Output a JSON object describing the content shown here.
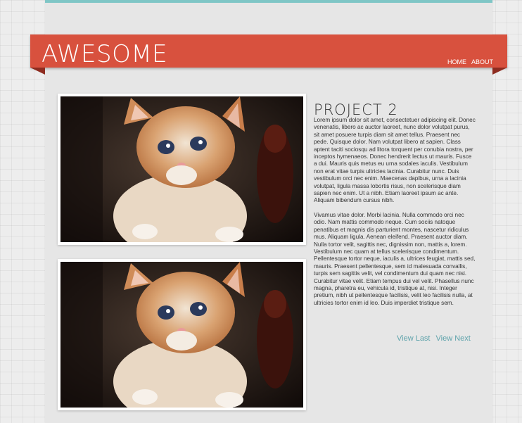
{
  "header": {
    "logo": "AWESOME",
    "nav": [
      {
        "label": "HOME"
      },
      {
        "label": "ABOUT"
      }
    ]
  },
  "project": {
    "title": "PROJECT 2",
    "paragraphs": [
      "Lorem ipsum dolor sit amet, consectetuer adipiscing elit. Donec venenatis, libero ac auctor laoreet, nunc dolor volutpat purus, sit amet posuere turpis diam sit amet tellus. Praesent nec pede. Quisque dolor. Nam volutpat libero at sapien. Class aptent taciti sociosqu ad litora torquent per conubia nostra, per inceptos hymenaeos. Donec hendrerit lectus ut mauris. Fusce a dui. Mauris quis metus eu urna sodales iaculis. Vestibulum non erat vitae turpis ultricies lacinia. Curabitur nunc. Duis vestibulum orci nec enim. Maecenas dapibus, urna a lacinia volutpat, ligula massa lobortis risus, non scelerisque diam sapien nec enim. Ut a nibh. Etiam laoreet ipsum ac ante. Aliquam bibendum cursus nibh.",
      "Vivamus vitae dolor. Morbi lacinia. Nulla commodo orci nec odio. Nam mattis commodo neque. Cum sociis natoque penatibus et magnis dis parturient montes, nascetur ridiculus mus. Aliquam ligula. Aenean eleifend. Praesent auctor diam. Nulla tortor velit, sagittis nec, dignissim non, mattis a, lorem. Vestibulum nec quam at tellus scelerisque condimentum. Pellentesque tortor neque, iaculis a, ultrices feugiat, mattis sed, mauris. Praesent pellentesque, sem id malesuada convallis, turpis sem sagittis velit, vel condimentum dui quam nec nisi. Curabitur vitae velit. Etiam tempus dui vel velit. Phasellus nunc magna, pharetra eu, vehicula id, tristique at, nisi. Integer pretium, nibh ut pellentesque facilisis, velit leo facilisis nulla, at ultricies tortor enim id leo. Duis imperdiet tristique sem."
    ],
    "pager": {
      "prev_label": "View Last",
      "next_label": "View Next"
    }
  },
  "colors": {
    "banner": "#d8513e",
    "top_rule": "#7fc6c6",
    "link": "#5fa3ab"
  }
}
